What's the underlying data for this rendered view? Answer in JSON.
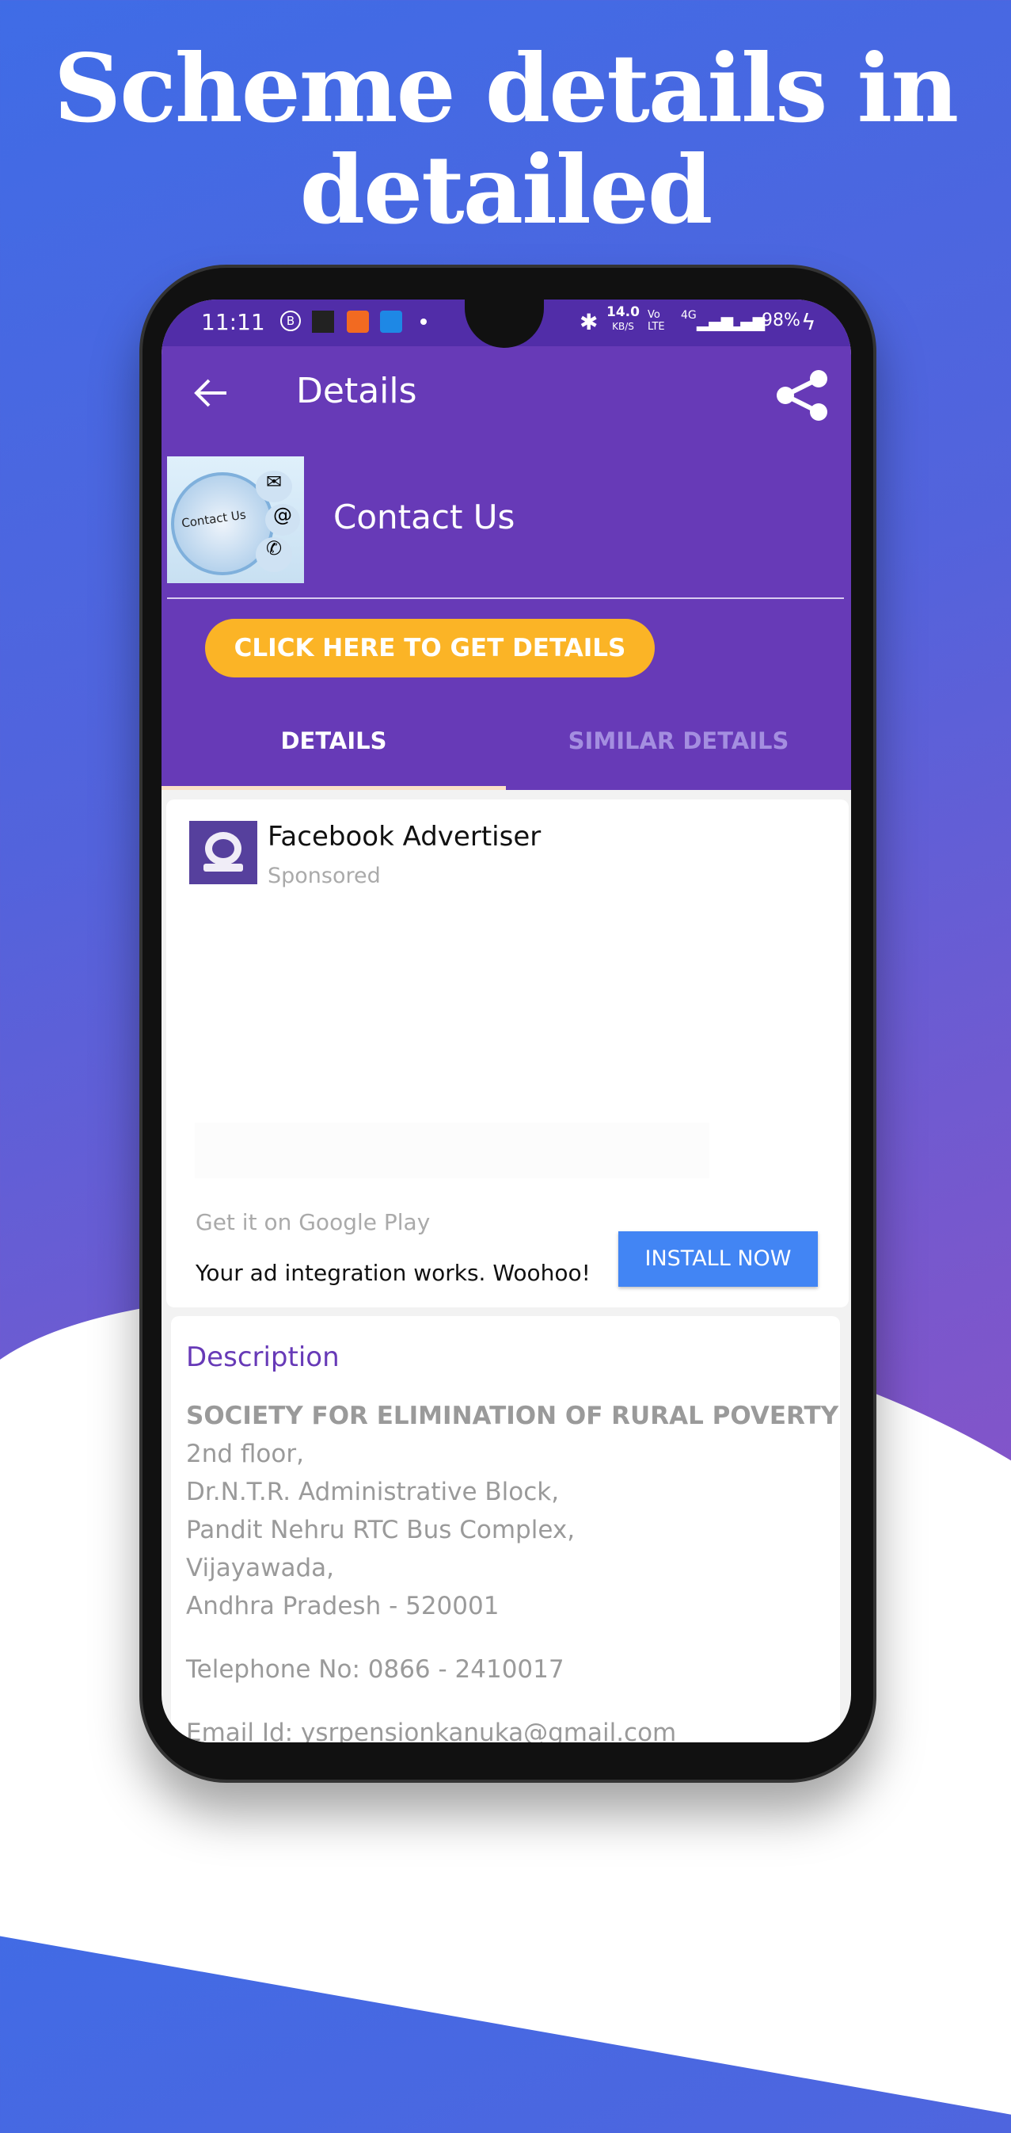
{
  "headline": {
    "line1": "Scheme details in",
    "line2": "detailed"
  },
  "status": {
    "time": "11:11",
    "speed": "14.0",
    "speed_unit": "KB/S",
    "volte": "Vo LTE",
    "network": "4G",
    "battery": "98%"
  },
  "toolbar": {
    "title": "Details",
    "back_icon": "arrow-left-icon",
    "share_icon": "share-icon"
  },
  "header": {
    "thumbnail_text": "Contact Us",
    "title": "Contact Us",
    "cta": "CLICK HERE TO GET DETAILS"
  },
  "tabs": [
    {
      "label": "DETAILS",
      "active": true
    },
    {
      "label": "SIMILAR DETAILS",
      "active": false
    }
  ],
  "ad": {
    "advertiser": "Facebook Advertiser",
    "sponsored": "Sponsored",
    "store": "Get it on Google Play",
    "body": "Your ad integration works. Woohoo!",
    "install": "INSTALL NOW"
  },
  "description": {
    "heading": "Description",
    "org": "SOCIETY FOR ELIMINATION OF RURAL POVERTY",
    "lines": [
      "2nd floor,",
      "Dr.N.T.R. Administrative Block,",
      "Pandit Nehru RTC Bus Complex,",
      "Vijayawada,",
      "Andhra Pradesh - 520001"
    ],
    "telephone": "Telephone No: 0866 - 2410017",
    "email": "Email Id: ysrpensionkanuka@gmail.com"
  },
  "colors": {
    "primary": "#673ab7",
    "accent": "#fbb426",
    "install": "#4285f4"
  }
}
